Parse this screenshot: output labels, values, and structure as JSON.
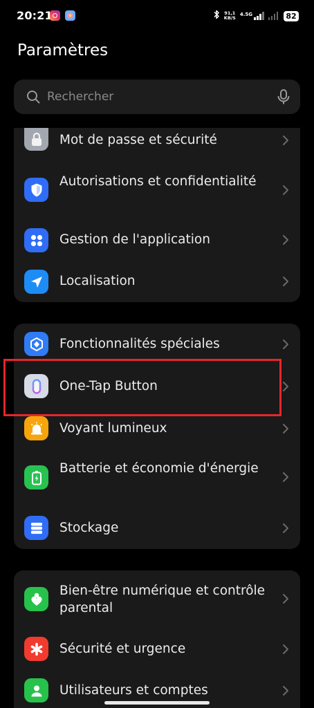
{
  "status_bar": {
    "time": "20:21",
    "speed_value": "91,1",
    "speed_unit": "KB/S",
    "network_label": "4.5G",
    "battery": "82"
  },
  "header": {
    "title": "Paramètres"
  },
  "search": {
    "placeholder": "Rechercher"
  },
  "groups": [
    {
      "items": [
        {
          "label": "Mot de passe et sécurité",
          "icon": "lock-icon",
          "color": "#9aa0a8"
        },
        {
          "label": "Autorisations et confidentialité",
          "icon": "shield-icon",
          "color": "#2f6df6"
        },
        {
          "label": "Gestion de l'application",
          "icon": "apps-grid-icon",
          "color": "#2f6df6"
        },
        {
          "label": "Localisation",
          "icon": "location-arrow-icon",
          "color": "#1e8cf5"
        }
      ]
    },
    {
      "items": [
        {
          "label": "Fonctionnalités spéciales",
          "icon": "special-features-icon",
          "color": "#2f7cf6"
        },
        {
          "label": "One-Tap Button",
          "icon": "one-tap-button-icon",
          "color": "#d7dbe6"
        },
        {
          "label": "Voyant lumineux",
          "icon": "notification-light-icon",
          "color": "#f7a50c"
        },
        {
          "label": "Batterie et économie d'énergie",
          "icon": "battery-icon",
          "color": "#28c251"
        },
        {
          "label": "Stockage",
          "icon": "storage-icon",
          "color": "#2f6df6"
        }
      ]
    },
    {
      "items": [
        {
          "label": "Bien-être numérique et contrôle parental",
          "icon": "digital-wellbeing-icon",
          "color": "#27c24c"
        },
        {
          "label": "Sécurité et urgence",
          "icon": "emergency-icon",
          "color": "#f23b2f"
        },
        {
          "label": "Utilisateurs et comptes",
          "icon": "user-icon",
          "color": "#27c24c"
        }
      ]
    }
  ],
  "highlight": {
    "target": "One-Tap Button",
    "color": "#e8262b"
  }
}
